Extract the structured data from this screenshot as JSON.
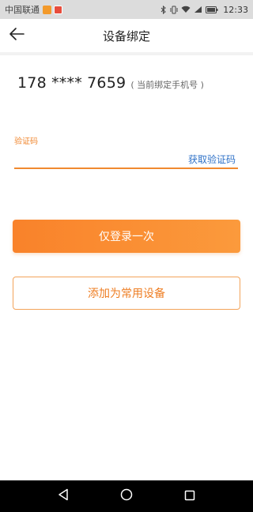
{
  "status_bar": {
    "carrier": "中国联通",
    "time": "12:33",
    "icons": [
      "bluetooth-icon",
      "vibrate-icon",
      "wifi-icon",
      "signal-icon",
      "battery-icon"
    ]
  },
  "header": {
    "title": "设备绑定",
    "back_icon": "arrow-left-icon"
  },
  "phone": {
    "number": "178 **** 7659",
    "hint": "( 当前绑定手机号 )"
  },
  "code_field": {
    "label": "验证码",
    "value": "",
    "placeholder": "",
    "get_code_label": "获取验证码"
  },
  "buttons": {
    "login_once": "仅登录一次",
    "add_common_device": "添加为常用设备"
  },
  "nav": {
    "icons": [
      "back-triangle-icon",
      "home-circle-icon",
      "recent-square-icon"
    ]
  },
  "colors": {
    "accent": "#f9822a",
    "link": "#2f72c8",
    "status_bar_bg": "#dcdcdc",
    "nav_bg": "#000000"
  }
}
